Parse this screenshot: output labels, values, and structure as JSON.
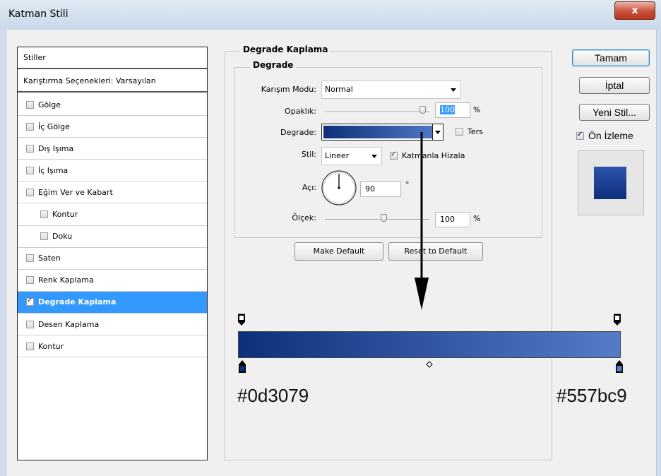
{
  "window": {
    "title": "Katman Stili",
    "close_label": "x"
  },
  "styles_panel": {
    "header": "Stiller",
    "blending": "Karıştırma Seçenekleri: Varsayılan",
    "items": [
      {
        "label": "Gölge",
        "checked": false,
        "indent": false,
        "selected": false
      },
      {
        "label": "İç Gölge",
        "checked": false,
        "indent": false,
        "selected": false
      },
      {
        "label": "Dış Işıma",
        "checked": false,
        "indent": false,
        "selected": false
      },
      {
        "label": "İç Işıma",
        "checked": false,
        "indent": false,
        "selected": false
      },
      {
        "label": "Eğim Ver ve Kabart",
        "checked": false,
        "indent": false,
        "selected": false
      },
      {
        "label": "Kontur",
        "checked": false,
        "indent": true,
        "selected": false
      },
      {
        "label": "Doku",
        "checked": false,
        "indent": true,
        "selected": false
      },
      {
        "label": "Saten",
        "checked": false,
        "indent": false,
        "selected": false
      },
      {
        "label": "Renk Kaplama",
        "checked": false,
        "indent": false,
        "selected": false
      },
      {
        "label": "Degrade Kaplama",
        "checked": true,
        "indent": false,
        "selected": true
      },
      {
        "label": "Desen Kaplama",
        "checked": false,
        "indent": false,
        "selected": false
      },
      {
        "label": "Kontur",
        "checked": false,
        "indent": false,
        "selected": false
      }
    ]
  },
  "gradient_overlay": {
    "group_title": "Degrade Kaplama",
    "sub_title": "Degrade",
    "blend_mode_label": "Karışım Modu:",
    "blend_mode_value": "Normal",
    "opacity_label": "Opaklık:",
    "opacity_value": "100",
    "opacity_unit": "%",
    "opacity_level": 1.0,
    "gradient_label": "Degrade:",
    "reverse_label": "Ters",
    "reverse_checked": false,
    "style_label": "Stil:",
    "style_value": "Lineer",
    "align_label": "Katmanla Hizala",
    "align_checked": true,
    "angle_label": "Açı:",
    "angle_value": "90",
    "angle_unit": "°",
    "scale_label": "Ölçek:",
    "scale_value": "100",
    "scale_unit": "%",
    "make_default_label": "Make Default",
    "reset_default_label": "Reset to Default"
  },
  "gradient_bar": {
    "start_color": "#0d3079",
    "end_color": "#557bc9",
    "start_label": "#0d3079",
    "end_label": "#557bc9"
  },
  "right_buttons": {
    "ok_label": "Tamam",
    "cancel_label": "İptal",
    "new_style_label": "Yeni Stil...",
    "preview_label": "Ön İzleme",
    "preview_checked": true
  },
  "colors": {
    "selection": "#3399ff",
    "swatch": "#2b54ad"
  },
  "icons": [
    "close-icon",
    "dropdown-arrow-icon",
    "angle-dial-icon",
    "down-arrow-icon",
    "color-stop-icon",
    "opacity-stop-icon",
    "midpoint-diamond-icon"
  ]
}
